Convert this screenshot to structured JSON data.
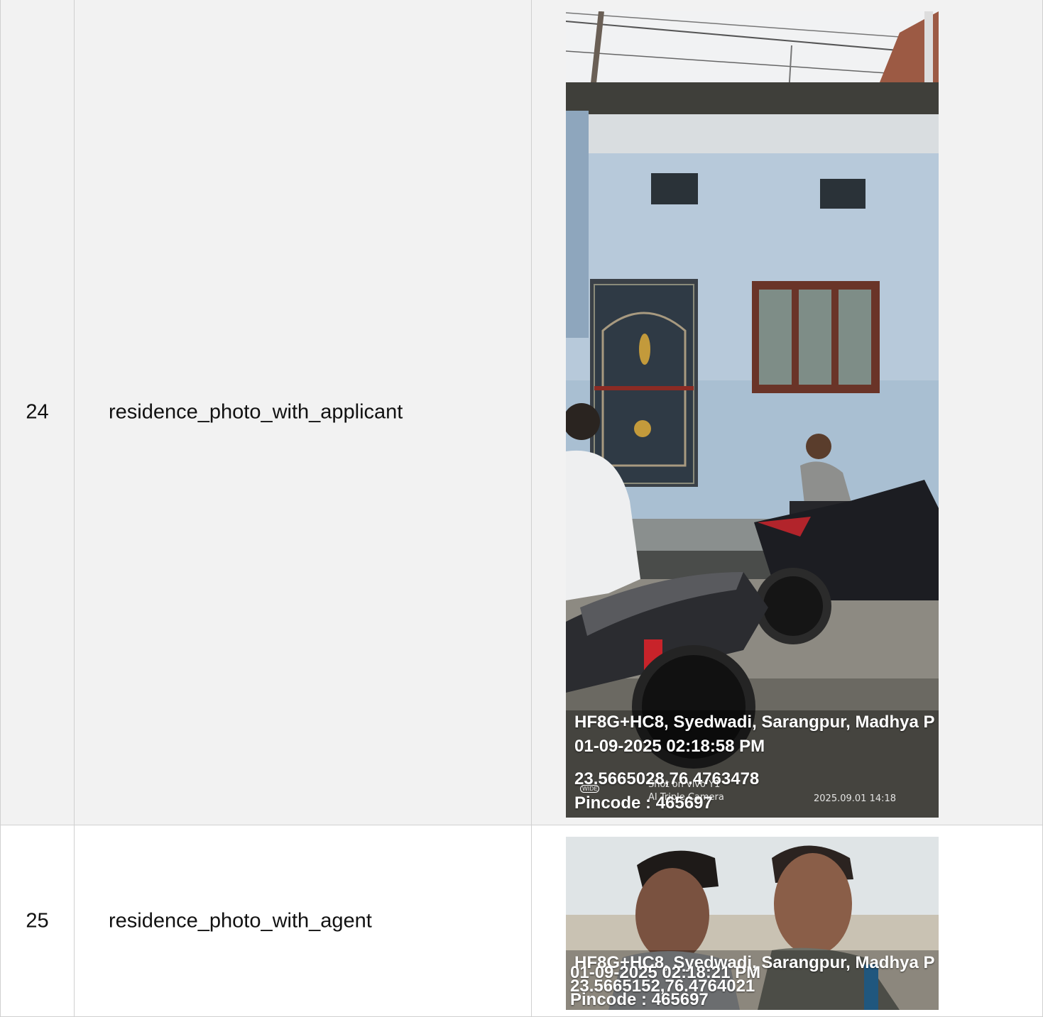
{
  "rows": [
    {
      "number": "24",
      "name": "residence_photo_with_applicant",
      "photo": {
        "address": "HF8G+HC8, Syedwadi, Sarangpur, Madhya P",
        "datetime": "01-09-2025 02:18:58 PM",
        "coords": "23.5665028,76.4763478",
        "pincode": "Pincode : 465697",
        "camera_line1": "Shot on vivo Y1",
        "camera_line2": "AI Triple Camera",
        "camera_badge": "WIDE",
        "stamp": "2025.09.01 14:18"
      }
    },
    {
      "number": "25",
      "name": "residence_photo_with_agent",
      "photo": {
        "address": "HF8G+HC8, Syedwadi, Sarangpur, Madhya P",
        "datetime": "01-09-2025 02:18:21 PM",
        "coords": "23.5665152,76.4764021",
        "pincode": "Pincode : 465697"
      }
    }
  ],
  "colors": {
    "row_alt_bg": "#f2f2f2",
    "border": "#d0d0d0",
    "wall": "#b7c9da",
    "sky": "#f1f2f3"
  }
}
